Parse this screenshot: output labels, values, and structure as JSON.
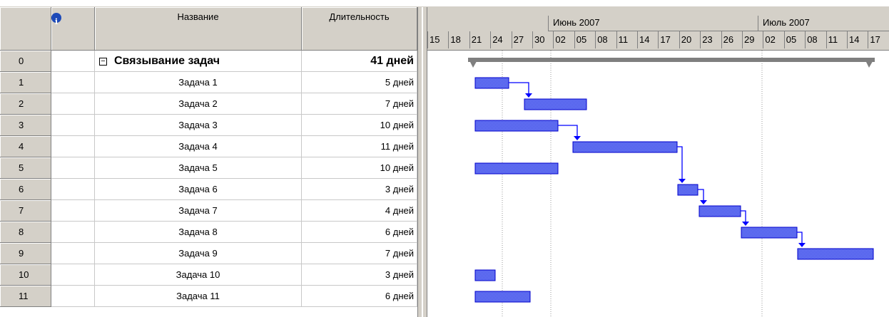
{
  "columns": {
    "info_icon": "i",
    "name": "Название",
    "duration": "Длительность"
  },
  "timescale": {
    "months": [
      "Июнь 2007",
      "Июль 2007"
    ],
    "days": [
      "15",
      "18",
      "21",
      "24",
      "27",
      "30",
      "02",
      "05",
      "08",
      "11",
      "14",
      "17",
      "20",
      "23",
      "26",
      "29",
      "02",
      "05",
      "08",
      "11",
      "14",
      "17"
    ]
  },
  "rows": [
    {
      "id": "0",
      "name": "Связывание задач",
      "duration": "41 дней",
      "summary": true
    },
    {
      "id": "1",
      "name": "Задача 1",
      "duration": "5 дней"
    },
    {
      "id": "2",
      "name": "Задача 2",
      "duration": "7 дней"
    },
    {
      "id": "3",
      "name": "Задача 3",
      "duration": "10 дней"
    },
    {
      "id": "4",
      "name": "Задача 4",
      "duration": "11 дней"
    },
    {
      "id": "5",
      "name": "Задача 5",
      "duration": "10 дней"
    },
    {
      "id": "6",
      "name": "Задача 6",
      "duration": "3 дней"
    },
    {
      "id": "7",
      "name": "Задача 7",
      "duration": "4 дней"
    },
    {
      "id": "8",
      "name": "Задача 8",
      "duration": "6 дней"
    },
    {
      "id": "9",
      "name": "Задача 9",
      "duration": "7 дней"
    },
    {
      "id": "10",
      "name": "Задача 10",
      "duration": "3 дней"
    },
    {
      "id": "11",
      "name": "Задача 11",
      "duration": "6 дней"
    }
  ],
  "colors": {
    "bar_fill": "#5b6bf0",
    "bar_border": "#0000cc",
    "link": "#0000ff",
    "summary": "#7f7f7f",
    "header_bg": "#d4d0c8"
  }
}
